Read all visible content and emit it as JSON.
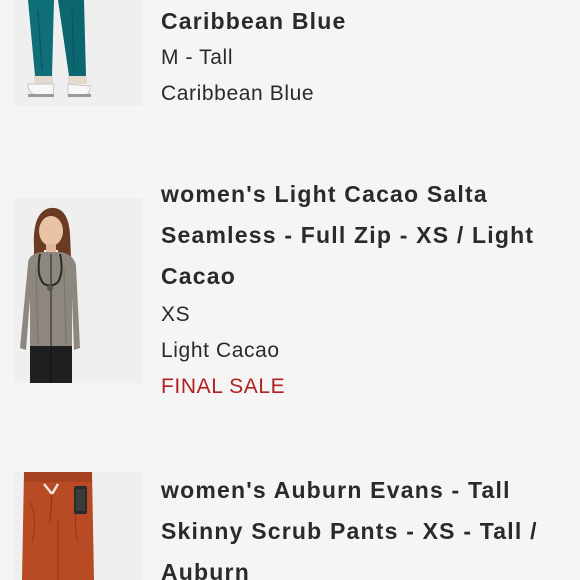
{
  "items": [
    {
      "title_tail": "Caribbean Blue",
      "size": "M - Tall",
      "color": "Caribbean Blue",
      "image": "teal-scrub-pants-photo"
    },
    {
      "title_lines": [
        "women's Light Cacao Salta",
        "Seamless - Full Zip - XS / Light",
        "Cacao"
      ],
      "size": "XS",
      "color": "Light Cacao",
      "badge": "FINAL SALE",
      "image": "light-cacao-zip-jacket-photo"
    },
    {
      "title_lines": [
        "women's Auburn Evans - Tall",
        "Skinny Scrub Pants - XS - Tall /",
        "Auburn"
      ],
      "image": "auburn-scrub-pants-photo"
    }
  ],
  "colors": {
    "background": "#f5f5f5",
    "text": "#2a2a2a",
    "final_sale": "#b22020"
  }
}
